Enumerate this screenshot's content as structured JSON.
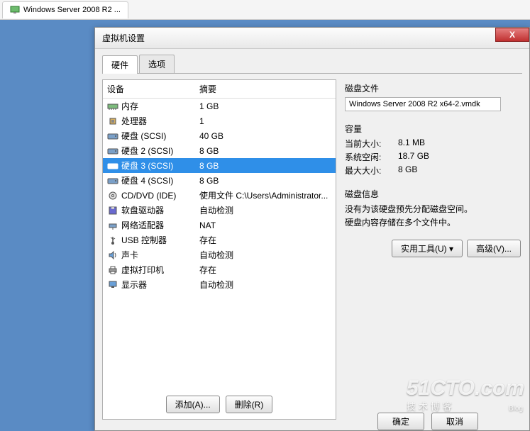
{
  "browser_tab": "Windows Server 2008 R2 ...",
  "dialog_title": "虚拟机设置",
  "close_x": "X",
  "tabs": {
    "hardware": "硬件",
    "options": "选项"
  },
  "columns": {
    "device": "设备",
    "summary": "摘要"
  },
  "devices": [
    {
      "icon": "memory",
      "name": "内存",
      "summary": "1 GB"
    },
    {
      "icon": "cpu",
      "name": "处理器",
      "summary": "1"
    },
    {
      "icon": "disk",
      "name": "硬盘 (SCSI)",
      "summary": "40 GB"
    },
    {
      "icon": "disk",
      "name": "硬盘 2 (SCSI)",
      "summary": "8 GB"
    },
    {
      "icon": "disk",
      "name": "硬盘 3 (SCSI)",
      "summary": "8 GB",
      "selected": true
    },
    {
      "icon": "disk",
      "name": "硬盘 4 (SCSI)",
      "summary": "8 GB"
    },
    {
      "icon": "cd",
      "name": "CD/DVD (IDE)",
      "summary": "使用文件 C:\\Users\\Administrator..."
    },
    {
      "icon": "floppy",
      "name": "软盘驱动器",
      "summary": "自动检测"
    },
    {
      "icon": "network",
      "name": "网络适配器",
      "summary": "NAT"
    },
    {
      "icon": "usb",
      "name": "USB 控制器",
      "summary": "存在"
    },
    {
      "icon": "sound",
      "name": "声卡",
      "summary": "自动检测"
    },
    {
      "icon": "printer",
      "name": "虚拟打印机",
      "summary": "存在"
    },
    {
      "icon": "display",
      "name": "显示器",
      "summary": "自动检测"
    }
  ],
  "add_btn": "添加(A)...",
  "remove_btn": "删除(R)",
  "right": {
    "disk_file_label": "磁盘文件",
    "disk_file_value": "Windows Server 2008 R2 x64-2.vmdk",
    "capacity_label": "容量",
    "current_size_label": "当前大小:",
    "current_size_value": "8.1 MB",
    "sys_free_label": "系统空闲:",
    "sys_free_value": "18.7 GB",
    "max_size_label": "最大大小:",
    "max_size_value": "8 GB",
    "disk_info_label": "磁盘信息",
    "disk_info_line1": "没有为该硬盘预先分配磁盘空间。",
    "disk_info_line2": "硬盘内容存储在多个文件中。",
    "utility_btn": "实用工具(U)",
    "advanced_btn": "高级(V)..."
  },
  "watermark": {
    "big": "51CTO.com",
    "small": "技术博客",
    "blog": "Blog"
  },
  "bottom": {
    "ok": "确定",
    "cancel": "取消"
  }
}
